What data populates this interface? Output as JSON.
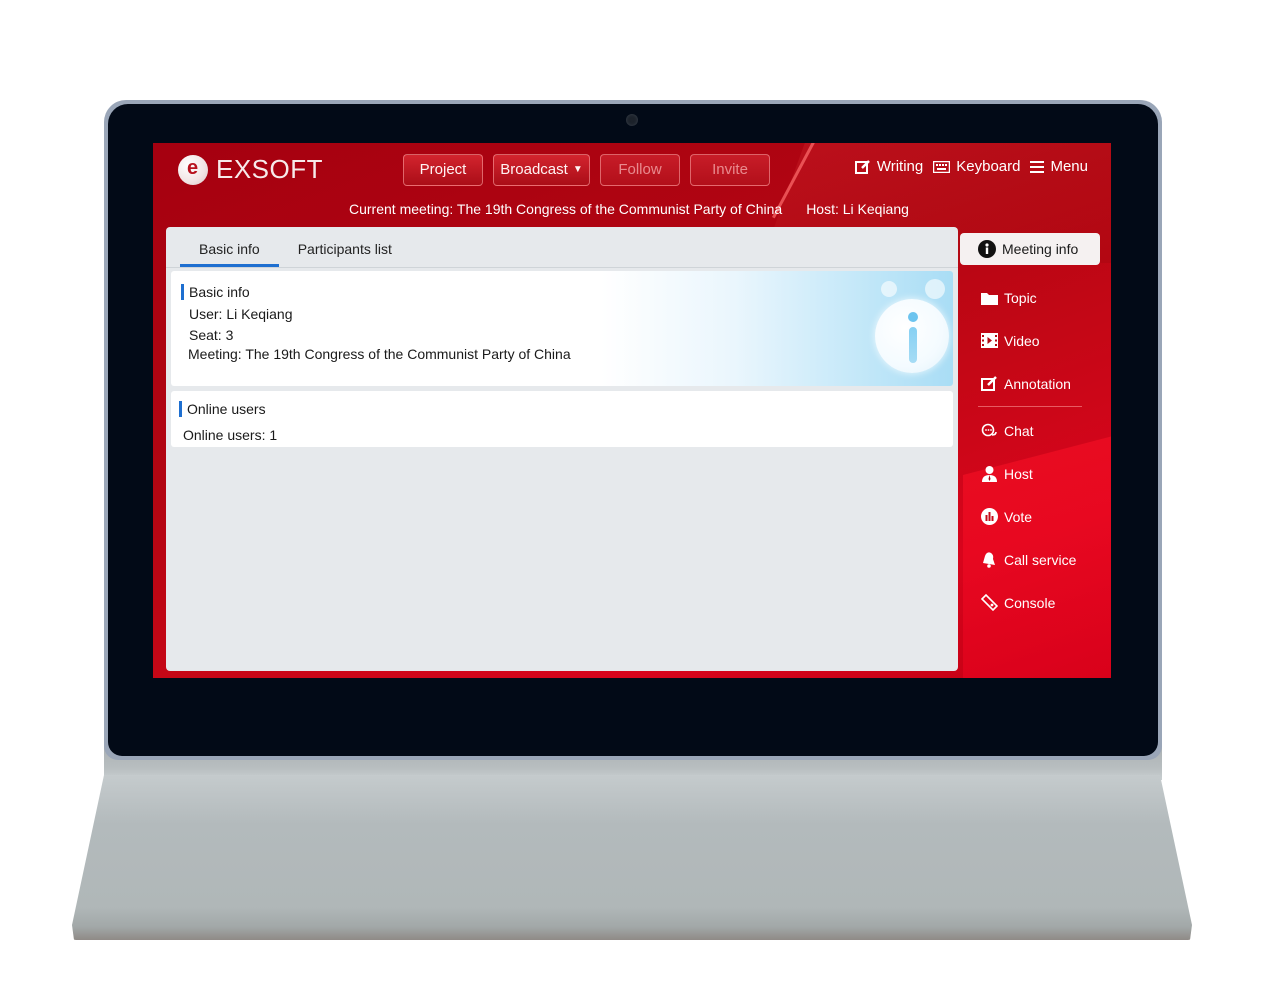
{
  "app": {
    "logo_text": "EXSOFT"
  },
  "toolbar": {
    "buttons": [
      {
        "label": "Project",
        "state": "enabled"
      },
      {
        "label": "Broadcast",
        "state": "enabled",
        "has_dropdown": true
      },
      {
        "label": "Follow",
        "state": "disabled"
      },
      {
        "label": "Invite",
        "state": "disabled"
      }
    ],
    "tools": [
      {
        "label": "Writing",
        "icon": "edit-icon"
      },
      {
        "label": "Keyboard",
        "icon": "keyboard-icon"
      },
      {
        "label": "Menu",
        "icon": "menu-icon"
      }
    ]
  },
  "meeting_bar": {
    "current_meeting": "Current meeting: The 19th Congress of the Communist Party of China",
    "host": "Host: Li Keqiang"
  },
  "tabs": [
    {
      "label": "Basic info",
      "active": true
    },
    {
      "label": "Participants list",
      "active": false
    }
  ],
  "basic_info": {
    "title": "Basic info",
    "user": "User: Li Keqiang",
    "seat": "Seat: 3",
    "meeting": "Meeting: The 19th Congress of the Communist Party of China"
  },
  "online_users": {
    "title": "Online users",
    "count_text": "Online users: 1"
  },
  "sidebar": {
    "items": [
      {
        "label": "Meeting info",
        "icon": "info-icon",
        "active": true
      },
      {
        "label": "Topic",
        "icon": "folder-icon"
      },
      {
        "label": "Video",
        "icon": "video-icon"
      },
      {
        "label": "Annotation",
        "icon": "edit-icon"
      },
      {
        "label": "Chat",
        "icon": "chat-icon"
      },
      {
        "label": "Host",
        "icon": "person-icon"
      },
      {
        "label": "Vote",
        "icon": "bar-chart-icon"
      },
      {
        "label": "Call service",
        "icon": "bell-icon"
      },
      {
        "label": "Console",
        "icon": "tag-icon"
      }
    ]
  },
  "colors": {
    "brand_red": "#b30612",
    "accent_blue": "#1e6fd0",
    "panel_bg": "#e6e9ec"
  }
}
